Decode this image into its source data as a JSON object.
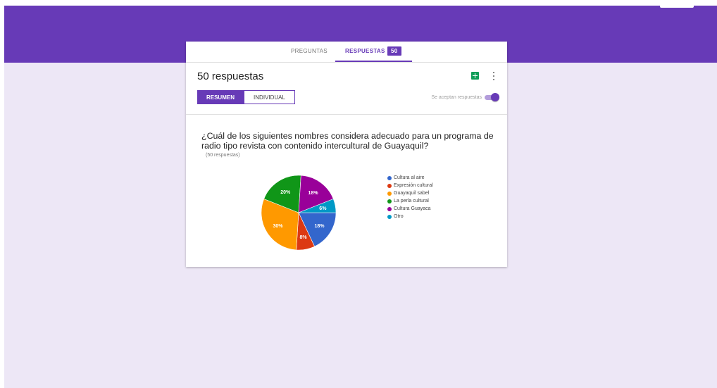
{
  "tabs": [
    {
      "label": "PREGUNTAS"
    },
    {
      "label": "RESPUESTAS",
      "badge": "50"
    }
  ],
  "summary": {
    "title": "50 respuestas",
    "views": [
      {
        "label": "RESUMEN"
      },
      {
        "label": "INDIVIDUAL"
      }
    ],
    "accepting_label": "Se aceptan respuestas",
    "accepting": true
  },
  "question": {
    "text": "¿Cuál de los siguientes nombres considera adecuado para un programa de radio tipo revista con contenido intercultural de Guayaquil?",
    "count_label": "(50 respuestas)"
  },
  "icons": [
    "sheets-icon",
    "more-vert-icon"
  ],
  "colors": {
    "accent": "#673ab7",
    "background": "#ede7f6"
  },
  "chart_data": {
    "type": "pie",
    "series": [
      {
        "name": "Cultura al aire",
        "value": 18,
        "label": "18%",
        "color": "#3366cc"
      },
      {
        "name": "Expresión cultural",
        "value": 8,
        "label": "8%",
        "color": "#dc3912"
      },
      {
        "name": "Guayaquil sabel",
        "value": 30,
        "label": "30%",
        "color": "#ff9900"
      },
      {
        "name": "La perla cultural",
        "value": 20,
        "label": "20%",
        "color": "#109618"
      },
      {
        "name": "Cultura Guayaca",
        "value": 18,
        "label": "18%",
        "color": "#990099"
      },
      {
        "name": "Otro",
        "value": 6,
        "label": "6%",
        "color": "#0099c6"
      }
    ],
    "legend_position": "right"
  }
}
